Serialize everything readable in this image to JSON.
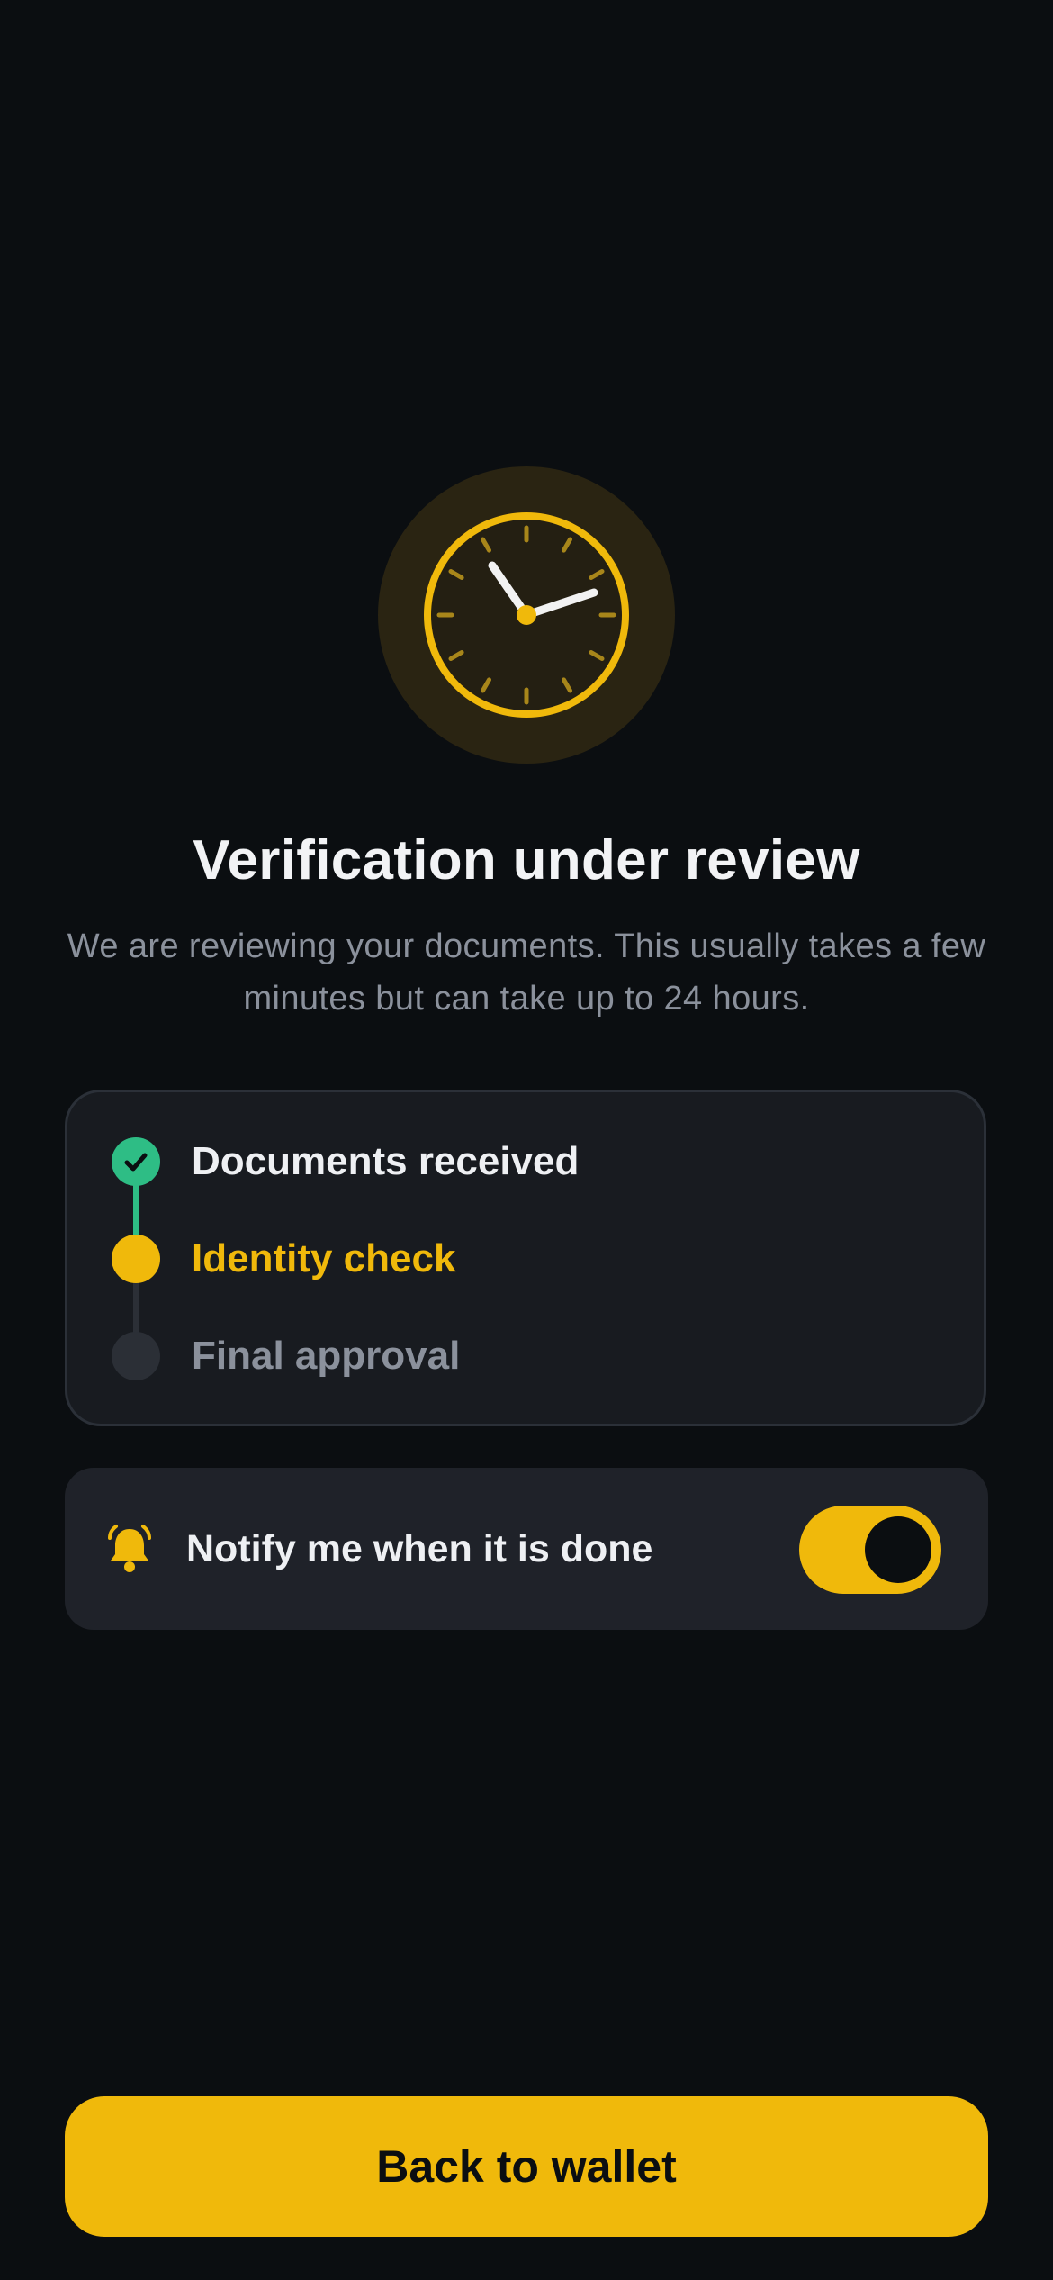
{
  "screen": {
    "title": "Verification under review",
    "subtitle": "We are reviewing your documents. This usually takes a few minutes but can take up to 24 hours.",
    "hero_icon": "clock-icon"
  },
  "steps": {
    "items": [
      {
        "label": "Documents received",
        "status": "done",
        "icon": "check-icon"
      },
      {
        "label": "Identity check",
        "status": "in-progress"
      },
      {
        "label": "Final approval",
        "status": "pending"
      }
    ]
  },
  "notify": {
    "label": "Notify me when it is done",
    "icon": "bell-icon",
    "enabled": true
  },
  "cta": {
    "label": "Back to wallet"
  },
  "colors": {
    "background": "#0b0e11",
    "accent": "#f0b90b",
    "success": "#2ebd85",
    "card": "#181b20",
    "muted_text": "#8b919c"
  }
}
